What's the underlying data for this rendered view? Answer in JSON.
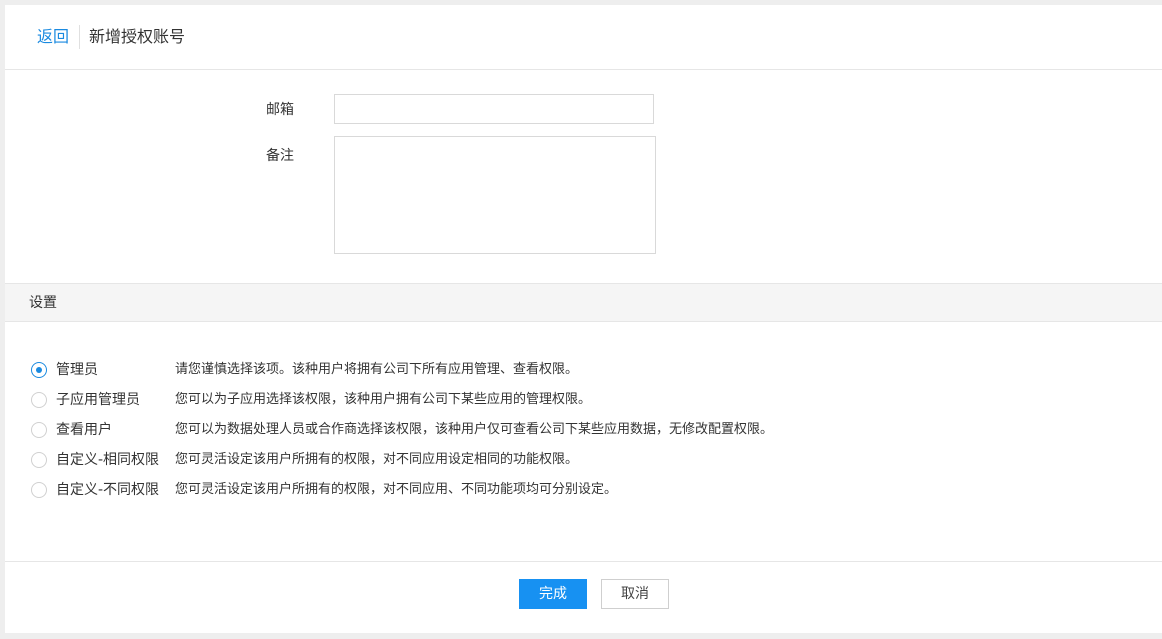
{
  "header": {
    "back_label": "返回",
    "title": "新增授权账号"
  },
  "form": {
    "email_label": "邮箱",
    "email_value": "",
    "note_label": "备注",
    "note_value": ""
  },
  "settings": {
    "section_title": "设置",
    "selected": "管理员",
    "roles": [
      {
        "name": "管理员",
        "description": "请您谨慎选择该项。该种用户将拥有公司下所有应用管理、查看权限。",
        "checked": true
      },
      {
        "name": "子应用管理员",
        "description": "您可以为子应用选择该权限，该种用户拥有公司下某些应用的管理权限。",
        "checked": false
      },
      {
        "name": "查看用户",
        "description": "您可以为数据处理人员或合作商选择该权限，该种用户仅可查看公司下某些应用数据，无修改配置权限。",
        "checked": false
      },
      {
        "name": "自定义-相同权限",
        "description": "您可灵活设定该用户所拥有的权限，对不同应用设定相同的功能权限。",
        "checked": false
      },
      {
        "name": "自定义-不同权限",
        "description": "您可灵活设定该用户所拥有的权限，对不同应用、不同功能项均可分别设定。",
        "checked": false
      }
    ]
  },
  "footer": {
    "confirm_label": "完成",
    "cancel_label": "取消"
  },
  "colors": {
    "accent": "#1791f2",
    "link": "#1a8ae0",
    "section_bg": "#f5f5f5"
  },
  "icons": [
    "radio-checked-icon",
    "radio-unchecked-icon"
  ]
}
